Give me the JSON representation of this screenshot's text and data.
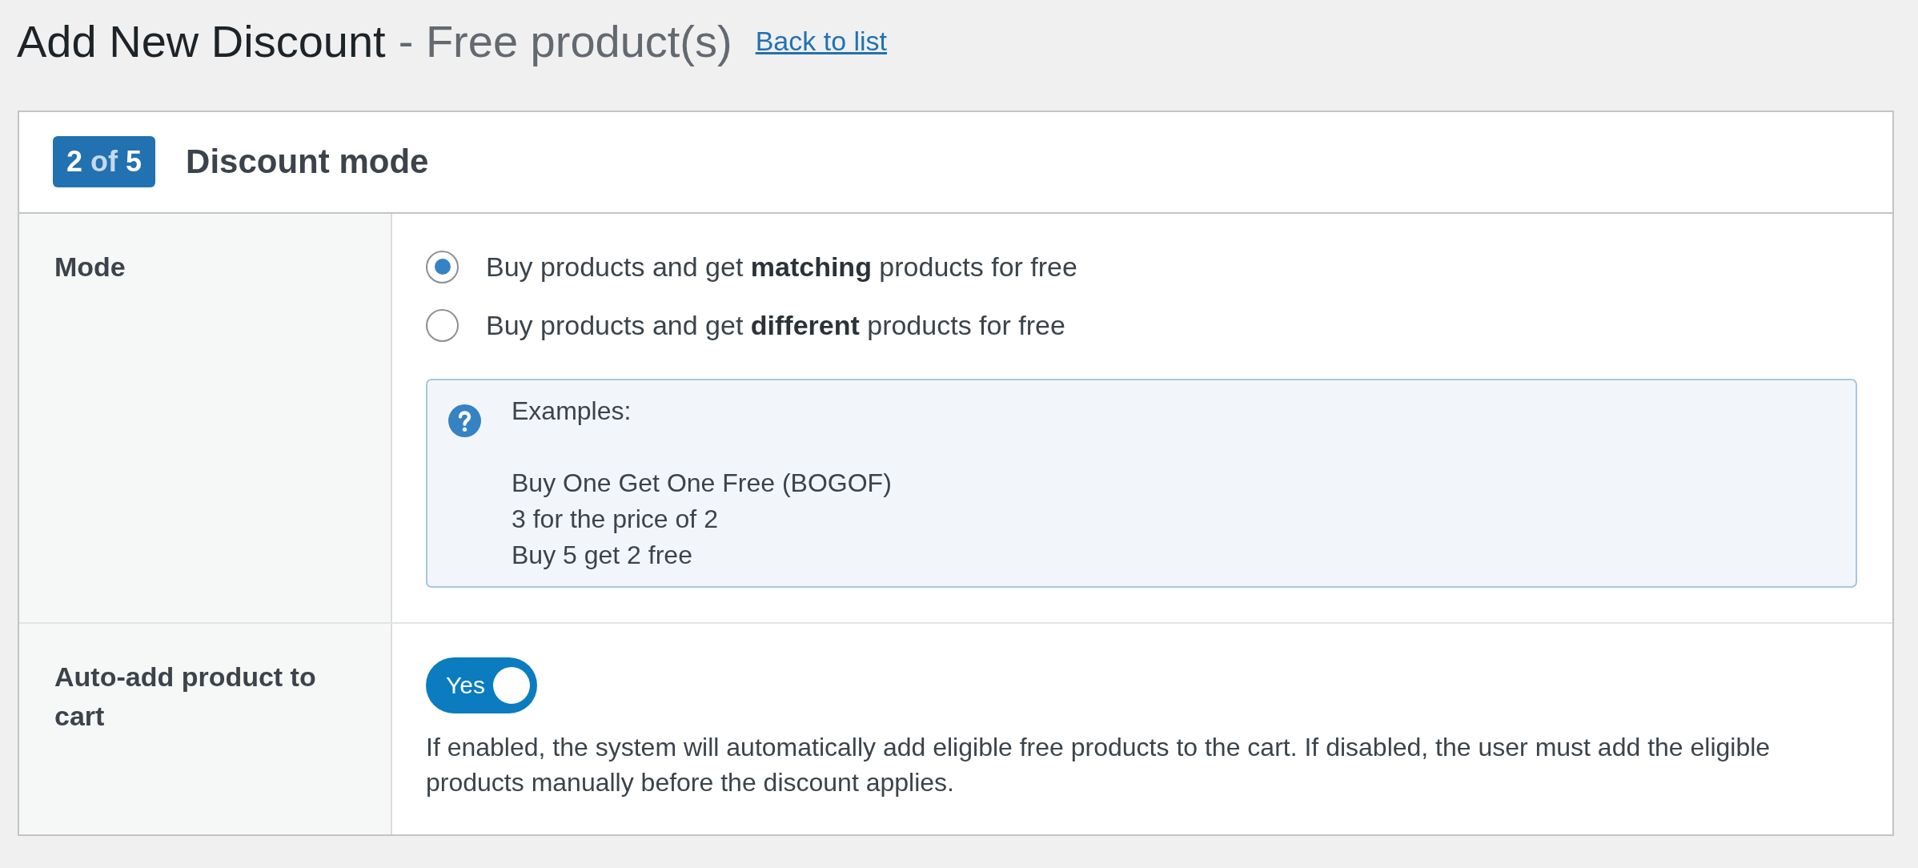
{
  "page_header": {
    "title": "Add New Discount",
    "subtitle": "- Free product(s)",
    "back_link": "Back to list"
  },
  "section": {
    "step_badge": {
      "current": "2",
      "separator": "of",
      "total": "5"
    },
    "title": "Discount mode",
    "fields": [
      {
        "kind": "radio_group",
        "label": "Mode",
        "options": [
          {
            "label": "Buy products and get **matching** products for free",
            "selected": true
          },
          {
            "label": "Buy products and get **different** products for free",
            "selected": false
          }
        ],
        "help": {
          "heading": "Examples:",
          "lines": [
            "Buy One Get One Free (BOGOF)",
            "3 for the price of 2",
            "Buy 5 get 2 free"
          ]
        }
      },
      {
        "kind": "toggle",
        "label": "Auto-add product to cart",
        "toggle": {
          "on": true,
          "text": "Yes"
        },
        "description": "If enabled, the system will automatically add eligible free products to the cart. If disabled, the user must add the eligible products manually before the discount applies."
      }
    ]
  }
}
